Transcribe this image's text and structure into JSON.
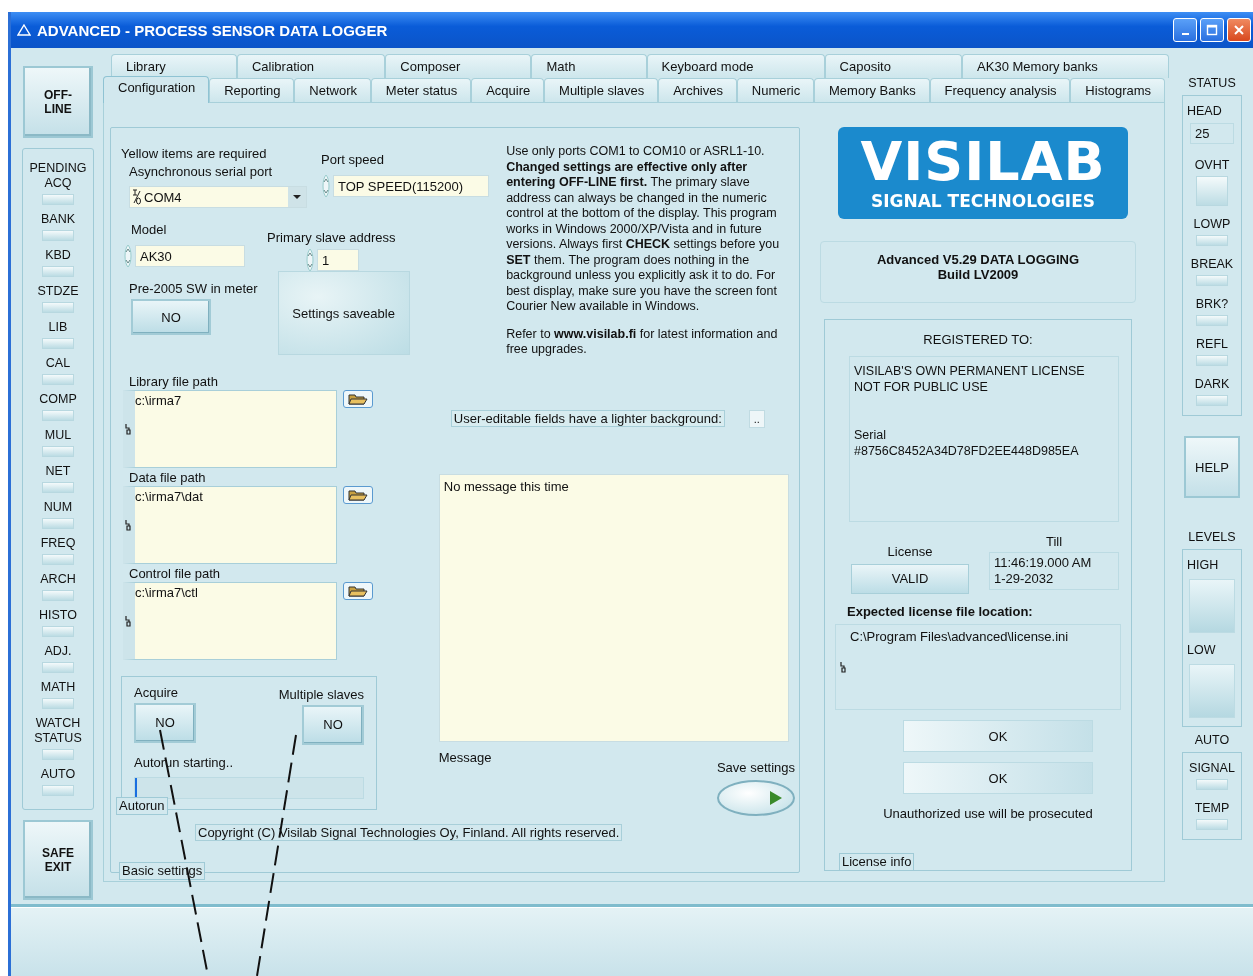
{
  "window": {
    "title": "ADVANCED - PROCESS SENSOR DATA LOGGER"
  },
  "left_panel": {
    "offline_button": "OFF-LINE",
    "pending_label": "PENDING",
    "indicators": [
      {
        "label": "ACQ",
        "on": false
      },
      {
        "label": "BANK",
        "on": false
      },
      {
        "label": "KBD",
        "on": false
      },
      {
        "label": "STDZE",
        "on": false
      },
      {
        "label": "LIB",
        "on": false
      },
      {
        "label": "CAL",
        "on": false
      },
      {
        "label": "COMP",
        "on": false
      },
      {
        "label": "MUL",
        "on": false
      },
      {
        "label": "NET",
        "on": false
      },
      {
        "label": "NUM",
        "on": false
      },
      {
        "label": "FREQ",
        "on": false
      },
      {
        "label": "ARCH",
        "on": false
      },
      {
        "label": "HISTO",
        "on": false
      },
      {
        "label": "ADJ.",
        "on": false
      },
      {
        "label": "MATH",
        "on": false
      },
      {
        "label": "WATCH STATUS",
        "on": false
      },
      {
        "label": "AUTO",
        "on": false
      }
    ],
    "safe_exit_button": "SAFE EXIT"
  },
  "tabs": {
    "row_1": [
      {
        "label": "Library",
        "selected": false
      },
      {
        "label": "Calibration",
        "selected": false
      },
      {
        "label": "Composer",
        "selected": false
      },
      {
        "label": "Math",
        "selected": false
      },
      {
        "label": "Keyboard mode",
        "selected": false
      },
      {
        "label": "Caposito",
        "selected": false
      },
      {
        "label": "AK30 Memory banks",
        "selected": false
      }
    ],
    "row_2": [
      {
        "label": "Configuration",
        "selected": true
      },
      {
        "label": "Reporting",
        "selected": false
      },
      {
        "label": "Network",
        "selected": false
      },
      {
        "label": "Meter status",
        "selected": false
      },
      {
        "label": "Acquire",
        "selected": false
      },
      {
        "label": "Multiple slaves",
        "selected": false
      },
      {
        "label": "Archives",
        "selected": false
      },
      {
        "label": "Numeric",
        "selected": false
      },
      {
        "label": "Memory Banks",
        "selected": false
      },
      {
        "label": "Frequency analysis",
        "selected": false
      },
      {
        "label": "Histograms",
        "selected": false
      }
    ]
  },
  "basic_settings": {
    "caption": "Basic settings",
    "required_note": "Yellow items are required",
    "serial_port": {
      "label": "Asynchronous serial port",
      "value": "COM4"
    },
    "port_speed": {
      "label": "Port speed",
      "value": "TOP SPEED(115200)"
    },
    "model": {
      "label": "Model",
      "value": "AK30"
    },
    "slave_address": {
      "label": "Primary slave address",
      "value": "1"
    },
    "pre_2005": {
      "label": "Pre-2005 SW in meter",
      "value": "NO"
    },
    "settings_saveable": "Settings saveable",
    "info_text": "Use only  ports COM1 to COM10 or ASRL1-10. **Changed settings are effective only after entering  OFF-LINE first.** The primary slave address can always be changed in the numeric control at the bottom of the display. This program works in Windows 2000/XP/Vista and in future versions. Always first **CHECK** settings before you **SET** them. The program does nothing in the background unless you explicitly ask it to do. For best display, make sure you have  the screen font Courier New available in Windows.",
    "refer_text": "Refer to **www.visilab.fi** for latest information and free upgrades.",
    "paths": [
      {
        "label": "Library file path",
        "value": "c:\\irma7"
      },
      {
        "label": "Data file path",
        "value": "c:\\irma7\\dat"
      },
      {
        "label": "Control file path",
        "value": "c:\\irma7\\ctl"
      }
    ],
    "editable_note": "User-editable fields have a lighter background:",
    "ellipsis_button": "..",
    "message": {
      "label": "Message",
      "value": "No message this time"
    },
    "autorun": {
      "caption": "Autorun",
      "acquire": {
        "label": "Acquire",
        "value": "NO"
      },
      "multiple_slaves": {
        "label": "Multiple slaves",
        "value": "NO"
      },
      "status": "Autorun starting..",
      "level": 0.01
    },
    "save_settings_label": "Save settings",
    "copyright": "Copyright (C) Visilab Signal Technologies Oy, Finland. All rights reserved."
  },
  "logo": {
    "title": "VISILAB",
    "subtitle": "SIGNAL TECHNOLOGIES"
  },
  "version": {
    "line_1": "Advanced V5.29 DATA LOGGING",
    "line_2": "Build LV2009"
  },
  "license_info": {
    "caption": "License info",
    "registered_label": "REGISTERED TO:",
    "holder_lines": [
      "VISILAB'S OWN PERMANENT LICENSE",
      "NOT FOR PUBLIC USE"
    ],
    "serial_label": "Serial",
    "serial": "#8756C8452A34D78FD2EE448D985EA",
    "license_label": "License",
    "license_value": "VALID",
    "till_label": "Till",
    "till_lines": [
      "11:46:19.000 AM",
      "1-29-2032"
    ],
    "location_label": "Expected license file location:",
    "location": "C:\\Program Files\\advanced\\license.ini",
    "ok_buttons": [
      "OK",
      "OK"
    ],
    "warning": "Unauthorized use will be prosecuted"
  },
  "status_panel": {
    "title": "STATUS",
    "head_label": "HEAD",
    "head_value": "25",
    "indicators": [
      {
        "label": "OVHT",
        "on": false
      },
      {
        "label": "LOWP",
        "on": false
      },
      {
        "label": "BREAK",
        "on": false
      },
      {
        "label": "BRK?",
        "on": false
      },
      {
        "label": "REFL",
        "on": false
      },
      {
        "label": "DARK",
        "on": false
      }
    ]
  },
  "help_button": "HELP",
  "levels": {
    "title": "LEVELS",
    "items": [
      {
        "label": "HIGH",
        "on": false
      },
      {
        "label": "LOW",
        "on": false
      }
    ]
  },
  "auto": {
    "title": "AUTO",
    "indicators": [
      {
        "label": "SIGNAL",
        "on": false
      },
      {
        "label": "TEMP",
        "on": false
      }
    ]
  }
}
